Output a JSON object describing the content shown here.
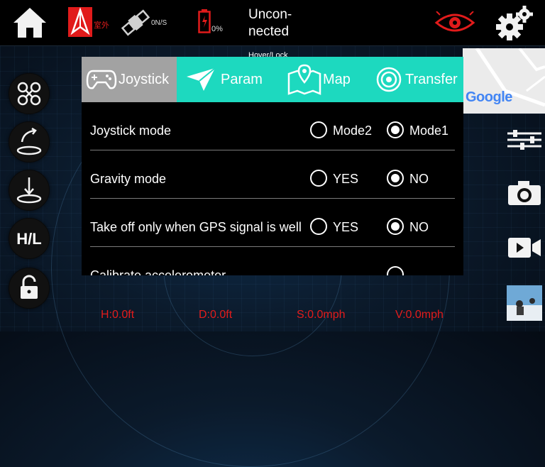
{
  "header": {
    "location_mode": "室外",
    "gps_count": "0N/S",
    "battery": "0%",
    "status_line1": "Uncon-",
    "status_line2": "nected"
  },
  "hover_label": "Hover/Lock",
  "tabs": [
    {
      "label": "Joystick",
      "icon": "gamepad-icon",
      "active": true
    },
    {
      "label": "Param",
      "icon": "paper-plane-icon",
      "active": false
    },
    {
      "label": "Map",
      "icon": "map-pin-icon",
      "active": false
    },
    {
      "label": "Transfer",
      "icon": "transfer-icon",
      "active": false
    }
  ],
  "settings": [
    {
      "label": "Joystick mode",
      "options": [
        "Mode2",
        "Mode1"
      ],
      "selected": "Mode1"
    },
    {
      "label": "Gravity mode",
      "options": [
        "YES",
        "NO"
      ],
      "selected": "NO"
    },
    {
      "label": "Take off only when GPS signal is well",
      "options": [
        "YES",
        "NO"
      ],
      "selected": "NO"
    },
    {
      "label": "Calibrate accelerometer",
      "options": [],
      "selected": ""
    }
  ],
  "map": {
    "brand": "Google"
  },
  "left_rail": [
    {
      "name": "drone-icon"
    },
    {
      "name": "takeoff-icon"
    },
    {
      "name": "land-icon"
    },
    {
      "name": "hl-speed-icon",
      "label": "H/L"
    },
    {
      "name": "lock-icon"
    }
  ],
  "right_rail": [
    {
      "name": "sliders-icon"
    },
    {
      "name": "camera-icon"
    },
    {
      "name": "video-icon"
    },
    {
      "name": "gallery-thumbnail"
    }
  ],
  "telemetry": {
    "height": "H:0.0ft",
    "distance": "D:0.0ft",
    "speed": "S:0.0mph",
    "vertical": "V:0.0mph"
  },
  "colors": {
    "accent": "#1dd9bf",
    "active_tab": "#a2a2a2",
    "alert": "#e31c1c"
  }
}
